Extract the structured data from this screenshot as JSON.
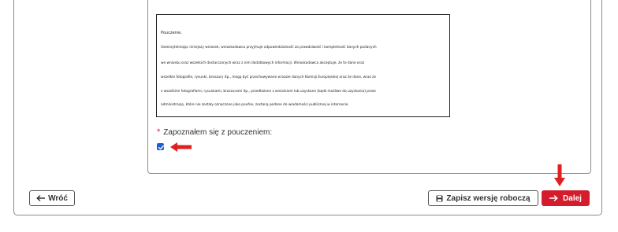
{
  "notice": {
    "heading": "Pouczenie.",
    "lines": [
      "Uwierzytelniając niniejszy wniosek, wnioskodawca przyjmuje odpowiedzialność za prawdziwość i kompletność danych podanych",
      "we wniosku oraz wszelkich dostarczonych wraz z nim dodatkowych informacji. Wnioskodawca akceptuje, że te dane oraz",
      "wszelkie fotografie, rysunki, broszury itp., mogą być przechowywane w bazie danych Komisji Europejskiej oraz że dane, wraz ze",
      "z wszelkimi fotografiami, rysunkami, broszurami itp., przedłożone z wnioskiem lub uzyskane (bądź możliwe do uzyskania) przez",
      "administrację, które nie zostały oznaczone jako poufne, zostaną podane do wiadomości publicznej w internecie."
    ]
  },
  "acknowledgement": {
    "required_mark": "*",
    "label": "Zapoznałem się z pouczeniem:",
    "checked": true
  },
  "buttons": {
    "back_label": "Wróć",
    "draft_label": "Zapisz wersję roboczą",
    "next_label": "Dalej"
  },
  "icons": {
    "back": "arrow-left-icon",
    "draft": "save-icon",
    "next": "arrow-right-icon"
  },
  "colors": {
    "accent": "#d41c2d",
    "checkbox": "#1a5fd6",
    "border": "#8c8c8c"
  }
}
